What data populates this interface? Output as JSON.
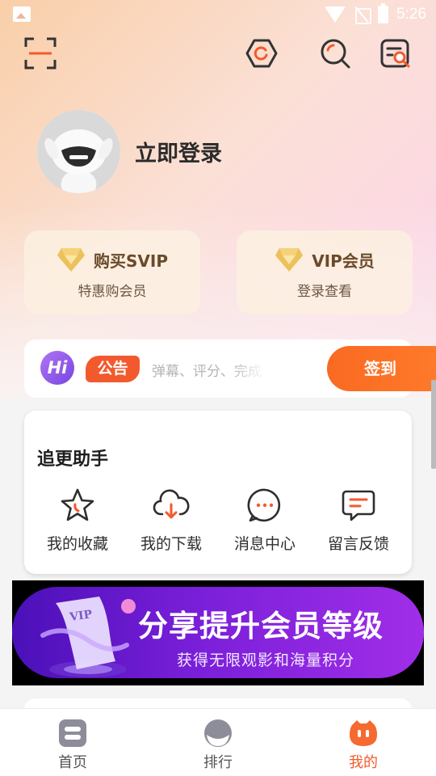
{
  "status_bar": {
    "time": "5:26"
  },
  "profile": {
    "login_label": "立即登录"
  },
  "vip_cards": [
    {
      "title": "购买SVIP",
      "subtitle": "特惠购会员"
    },
    {
      "title": "VIP会员",
      "subtitle": "登录查看"
    }
  ],
  "notice": {
    "hi_label": "Hi",
    "badge": "公告",
    "text": "弹幕、评分、完成",
    "checkin_label": "签到"
  },
  "helper": {
    "title": "追更助手",
    "items": [
      {
        "label": "我的收藏",
        "icon": "star-icon"
      },
      {
        "label": "我的下载",
        "icon": "cloud-download-icon"
      },
      {
        "label": "消息中心",
        "icon": "message-icon"
      },
      {
        "label": "留言反馈",
        "icon": "feedback-icon"
      }
    ]
  },
  "banner": {
    "doc_label": "VIP",
    "title": "分享提升会员等级",
    "subtitle": "获得无限观影和海量积分"
  },
  "bottom_nav": [
    {
      "label": "首页",
      "icon": "home-icon",
      "active": false
    },
    {
      "label": "排行",
      "icon": "ranking-icon",
      "active": false
    },
    {
      "label": "我的",
      "icon": "mine-icon",
      "active": true
    }
  ],
  "colors": {
    "accent": "#f55a2a",
    "checkin": "#f96a22",
    "vip_gold": "#e8b64a",
    "banner_purple": "#7a1fd9"
  }
}
